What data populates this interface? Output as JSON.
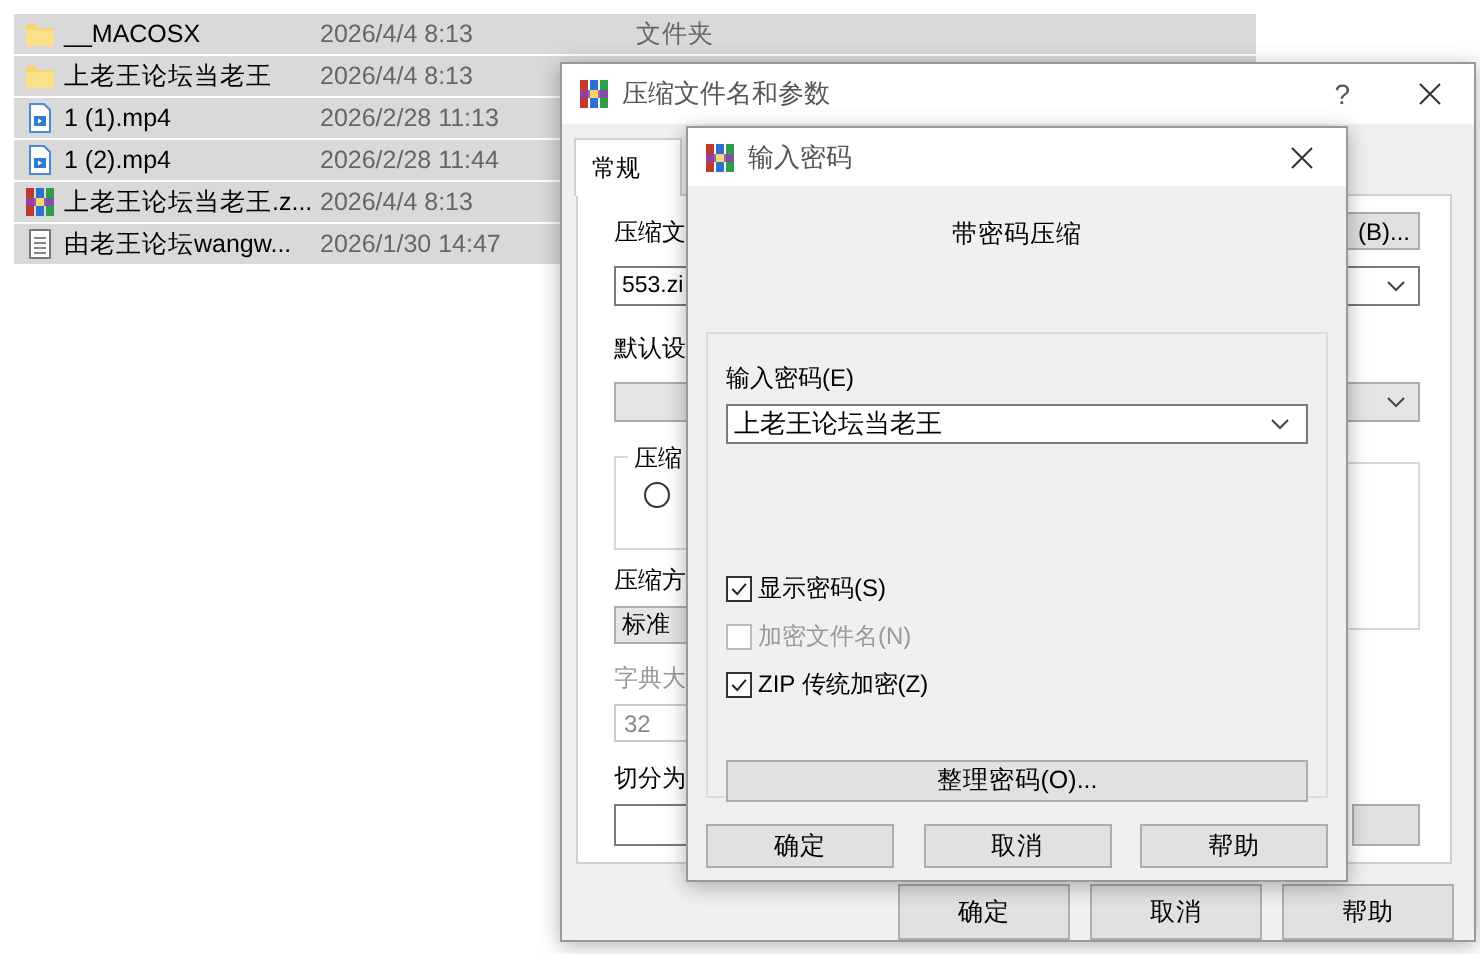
{
  "file_list": {
    "rows": [
      {
        "kind": "folder",
        "name": "__MACOSX",
        "date": "2026/4/4 8:13",
        "type": "文件夹",
        "selected": true
      },
      {
        "kind": "folder",
        "name": "上老王论坛当老王",
        "date": "2026/4/4 8:13",
        "selected": true
      },
      {
        "kind": "video",
        "name": "1 (1).mp4",
        "date": "2026/2/28 11:13",
        "selected": true
      },
      {
        "kind": "video",
        "name": "1 (2).mp4",
        "date": "2026/2/28 11:44",
        "selected": true
      },
      {
        "kind": "archive",
        "name": "上老王论坛当老王.z...",
        "date": "2026/4/4 8:13",
        "selected": true
      },
      {
        "kind": "text",
        "name": "由老王论坛wangw...",
        "date": "2026/1/30 14:47",
        "selected": true
      }
    ]
  },
  "archive_dialog": {
    "title": "压缩文件名和参数",
    "help": "?",
    "tabs": [
      {
        "label": "常规",
        "selected": true
      }
    ],
    "archive_name_label": "压缩文",
    "archive_name_value": "553.zi",
    "browse_button": "(B)...",
    "profile_label": "默认设",
    "format_group_label": "压缩",
    "format_radio": {
      "selected": false
    },
    "method_label": "压缩方",
    "method_value": "标准",
    "dictionary_label": "字典大",
    "dictionary_value": "32",
    "dictionary_disabled": true,
    "split_label": "切分为",
    "buttons": [
      "确定",
      "取消",
      "帮助"
    ]
  },
  "password_dialog": {
    "title": "输入密码",
    "heading": "带密码压缩",
    "password_label": "输入密码(E)",
    "password_value": "上老王论坛当老王",
    "options": [
      {
        "label": "显示密码(S)",
        "checked": true,
        "disabled": false
      },
      {
        "label": "加密文件名(N)",
        "checked": false,
        "disabled": true
      },
      {
        "label": "ZIP 传统加密(Z)",
        "checked": true,
        "disabled": false
      }
    ],
    "organize_button": "整理密码(O)...",
    "buttons": [
      "确定",
      "取消",
      "帮助"
    ]
  }
}
